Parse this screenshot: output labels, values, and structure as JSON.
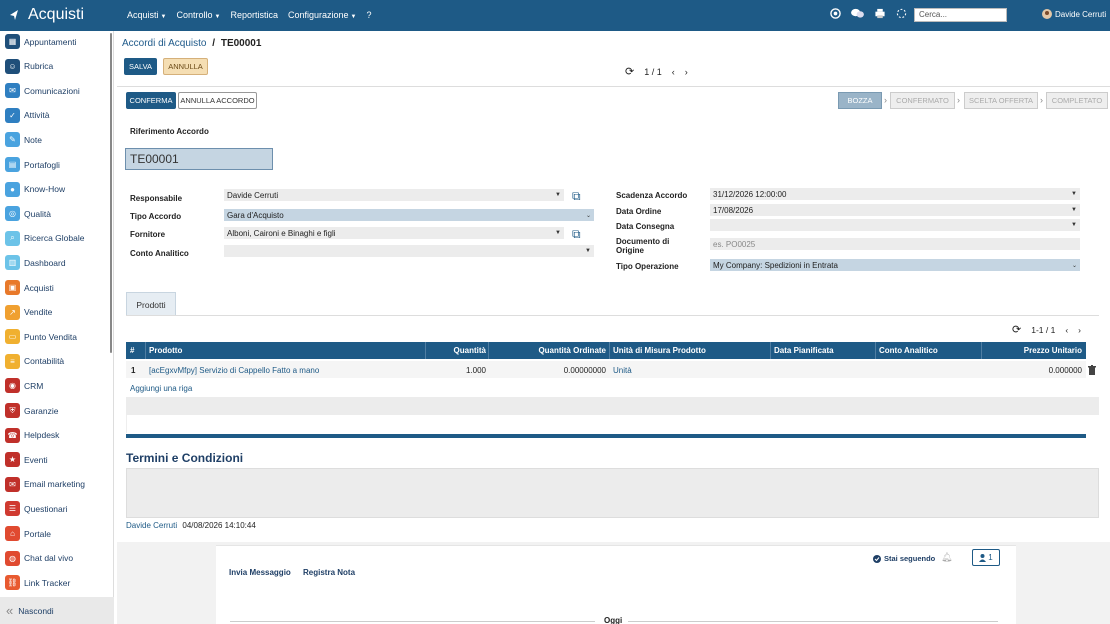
{
  "app": {
    "title": "Acquisti"
  },
  "topmenu": [
    {
      "label": "Acquisti",
      "caret": true
    },
    {
      "label": "Controllo",
      "caret": true
    },
    {
      "label": "Reportistica",
      "caret": false
    },
    {
      "label": "Configurazione",
      "caret": true
    },
    {
      "label": "?",
      "caret": false
    }
  ],
  "topbar": {
    "search_placeholder": "Cerca...",
    "user": "Davide Cerruti"
  },
  "sidebar": {
    "items": [
      {
        "label": "Appuntamenti",
        "color": "#1f4f7a",
        "icon": "calendar-icon"
      },
      {
        "label": "Rubrica",
        "color": "#1f4f7a",
        "icon": "contacts-icon"
      },
      {
        "label": "Comunicazioni",
        "color": "#2f7fc1",
        "icon": "chat-icon"
      },
      {
        "label": "Attività",
        "color": "#2f7fc1",
        "icon": "check-icon"
      },
      {
        "label": "Note",
        "color": "#4aa3df",
        "icon": "pencil-icon"
      },
      {
        "label": "Portafogli",
        "color": "#4aa3df",
        "icon": "wallet-icon"
      },
      {
        "label": "Know-How",
        "color": "#4aa3df",
        "icon": "bulb-icon"
      },
      {
        "label": "Qualità",
        "color": "#4aa3df",
        "icon": "quality-icon"
      },
      {
        "label": "Ricerca Globale",
        "color": "#6cc3e8",
        "icon": "search-icon"
      },
      {
        "label": "Dashboard",
        "color": "#6cc3e8",
        "icon": "dashboard-icon"
      },
      {
        "label": "Acquisti",
        "color": "#e8792a",
        "icon": "cart-icon"
      },
      {
        "label": "Vendite",
        "color": "#f0a030",
        "icon": "sales-icon"
      },
      {
        "label": "Punto Vendita",
        "color": "#f0b030",
        "icon": "pos-icon"
      },
      {
        "label": "Contabilità",
        "color": "#f0b030",
        "icon": "accounting-icon"
      },
      {
        "label": "CRM",
        "color": "#c0302a",
        "icon": "crm-icon"
      },
      {
        "label": "Garanzie",
        "color": "#c0302a",
        "icon": "warranty-icon"
      },
      {
        "label": "Helpdesk",
        "color": "#c0302a",
        "icon": "helpdesk-icon"
      },
      {
        "label": "Eventi",
        "color": "#c0302a",
        "icon": "event-icon"
      },
      {
        "label": "Email marketing",
        "color": "#c0302a",
        "icon": "email-icon"
      },
      {
        "label": "Questionari",
        "color": "#d03a30",
        "icon": "survey-icon"
      },
      {
        "label": "Portale",
        "color": "#e04a30",
        "icon": "portal-icon"
      },
      {
        "label": "Chat dal vivo",
        "color": "#e04a30",
        "icon": "livechat-icon"
      },
      {
        "label": "Link Tracker",
        "color": "#e85a30",
        "icon": "link-icon"
      }
    ],
    "hide_label": "Nascondi"
  },
  "breadcrumb": {
    "parent": "Accordi di Acquisto",
    "sep": "/",
    "current": "TE00001"
  },
  "actions": {
    "save": "SALVA",
    "discard": "ANNULLA"
  },
  "pager": {
    "value": "1 / 1"
  },
  "header_buttons": {
    "confirm": "CONFERMA",
    "cancel_agreement": "ANNULLA ACCORDO"
  },
  "statusbar": [
    "BOZZA",
    "CONFERMATO",
    "SCELTA OFFERTA",
    "COMPLETATO"
  ],
  "form": {
    "ref_label": "Riferimento Accordo",
    "ref_value": "TE00001",
    "left": [
      {
        "label": "Responsabile",
        "value": "Davide Cerruti"
      },
      {
        "label": "Tipo Accordo",
        "value": "Gara d'Acquisto"
      },
      {
        "label": "Fornitore",
        "value": "Alboni, Caironi e Binaghi e figli"
      },
      {
        "label": "Conto Analitico",
        "value": ""
      }
    ],
    "right": [
      {
        "label": "Scadenza Accordo",
        "value": "31/12/2026 12:00:00"
      },
      {
        "label": "Data Ordine",
        "value": "17/08/2026"
      },
      {
        "label": "Data Consegna",
        "value": ""
      },
      {
        "label": "Documento di Origine",
        "placeholder": "es. PO0025"
      },
      {
        "label": "Tipo Operazione",
        "value": "My Company: Spedizioni in Entrata"
      }
    ]
  },
  "tab": {
    "label": "Prodotti"
  },
  "table": {
    "pager": "1-1 / 1",
    "headers": [
      "#",
      "Prodotto",
      "Quantità",
      "Quantità Ordinate",
      "Unità di Misura Prodotto",
      "Data Pianificata",
      "Conto Analitico",
      "Prezzo Unitario"
    ],
    "rows": [
      {
        "n": "1",
        "product": "[acEgxvMfpy] Servizio di Cappello Fatto a mano",
        "qty": "1.000",
        "qty_ordered": "0.00000000",
        "uom": "Unità",
        "date": "",
        "account": "",
        "price": "0.000000"
      }
    ],
    "add_line": "Aggiungi una riga"
  },
  "terms": {
    "title": "Termini e Condizioni"
  },
  "signature": {
    "author": "Davide Cerruti",
    "date": "04/08/2026 14:10:44"
  },
  "chatter": {
    "send_message": "Invia Messaggio",
    "log_note": "Registra Nota",
    "following": "Stai seguendo",
    "followers": "1",
    "today": "Oggi"
  }
}
